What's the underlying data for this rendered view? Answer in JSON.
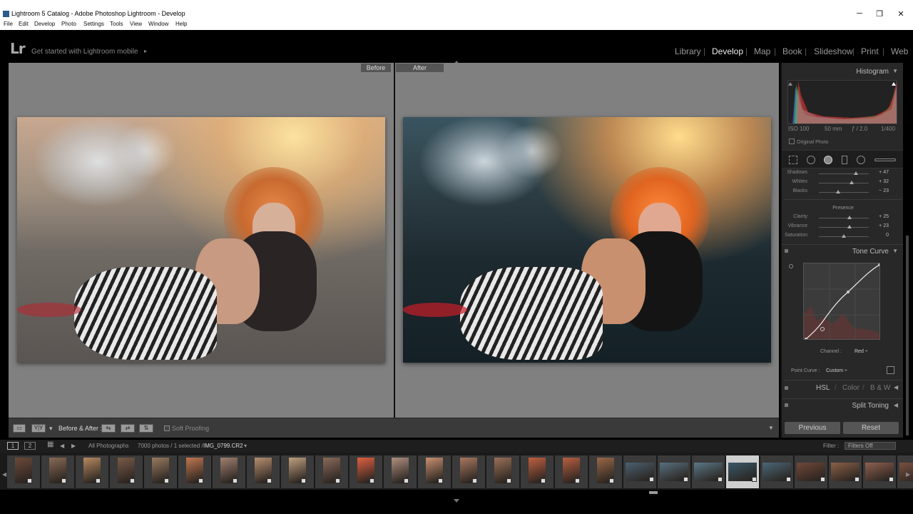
{
  "window": {
    "title": "Lightroom 5 Catalog - Adobe Photoshop Lightroom - Develop",
    "minimize": "─",
    "maximize": "❐",
    "close": "✕"
  },
  "menu": [
    "File",
    "Edit",
    "Develop",
    "Photo",
    "Settings",
    "Tools",
    "View",
    "Window",
    "Help"
  ],
  "topbar": {
    "logo": "Lr",
    "mobile_link": "Get started with Lightroom mobile",
    "mobile_arrow": "▸",
    "modules": [
      "Library",
      "Develop",
      "Map",
      "Book",
      "Slideshow",
      "Print",
      "Web"
    ],
    "active_module": "Develop",
    "separator": "|"
  },
  "view": {
    "before_label": "Before",
    "after_label": "After"
  },
  "toolbar": {
    "loupe_icon": "▭",
    "yy_label": "Y|Y",
    "dd_caret": "▾",
    "before_after_label": "Before & After :",
    "swap_icon_1": "⇆",
    "swap_icon_2": "⇄",
    "swap_icon_3": "⇅",
    "soft_proofing": "Soft Proofing",
    "toolbar_caret": "▼"
  },
  "histogram": {
    "title": "Histogram",
    "iso": "ISO 100",
    "focal": "50 mm",
    "aperture": "ƒ / 2.0",
    "shutter": "1/400",
    "original_photo": "Original Photo",
    "collapse": "▼"
  },
  "sliders": [
    {
      "name": "Shadows",
      "value": "+ 47",
      "pos": 0.74
    },
    {
      "name": "Whites",
      "value": "+ 32",
      "pos": 0.66
    },
    {
      "name": "Blacks",
      "value": "− 23",
      "pos": 0.38
    }
  ],
  "presence": {
    "title": "Presence",
    "items": [
      {
        "name": "Clarity",
        "value": "+ 25",
        "pos": 0.62
      },
      {
        "name": "Vibrance",
        "value": "+ 23",
        "pos": 0.61
      },
      {
        "name": "Saturation",
        "value": "0",
        "pos": 0.5
      }
    ]
  },
  "tone_curve": {
    "title": "Tone Curve",
    "channel_label": "Channel :",
    "channel_value": "Red ÷",
    "point_curve_label": "Point Curve :",
    "point_curve_value": "Custom ÷",
    "collapse": "▼"
  },
  "panels": {
    "hsl": "HSL",
    "color": "Color",
    "bw": "B & W",
    "slash": "/",
    "split_toning": "Split Toning",
    "expand": "◀"
  },
  "buttons": {
    "previous": "Previous",
    "reset": "Reset"
  },
  "filmstrip": {
    "monitor_1": "1",
    "monitor_2": "2",
    "grid_icon": "▦",
    "back": "◀",
    "forward": "▶",
    "source": "All Photographs",
    "count": "7000 photos / 1 selected /",
    "filename": "IMG_0799.CR2",
    "filename_caret": "▾",
    "filter_label": "Filter :",
    "filter_value": "Filters Off",
    "left_arrow": "◀",
    "right_arrow": "▶"
  },
  "colors": {
    "accent_active": "#eeeeee",
    "panel_bg": "#282828",
    "work_bg": "#808080"
  }
}
